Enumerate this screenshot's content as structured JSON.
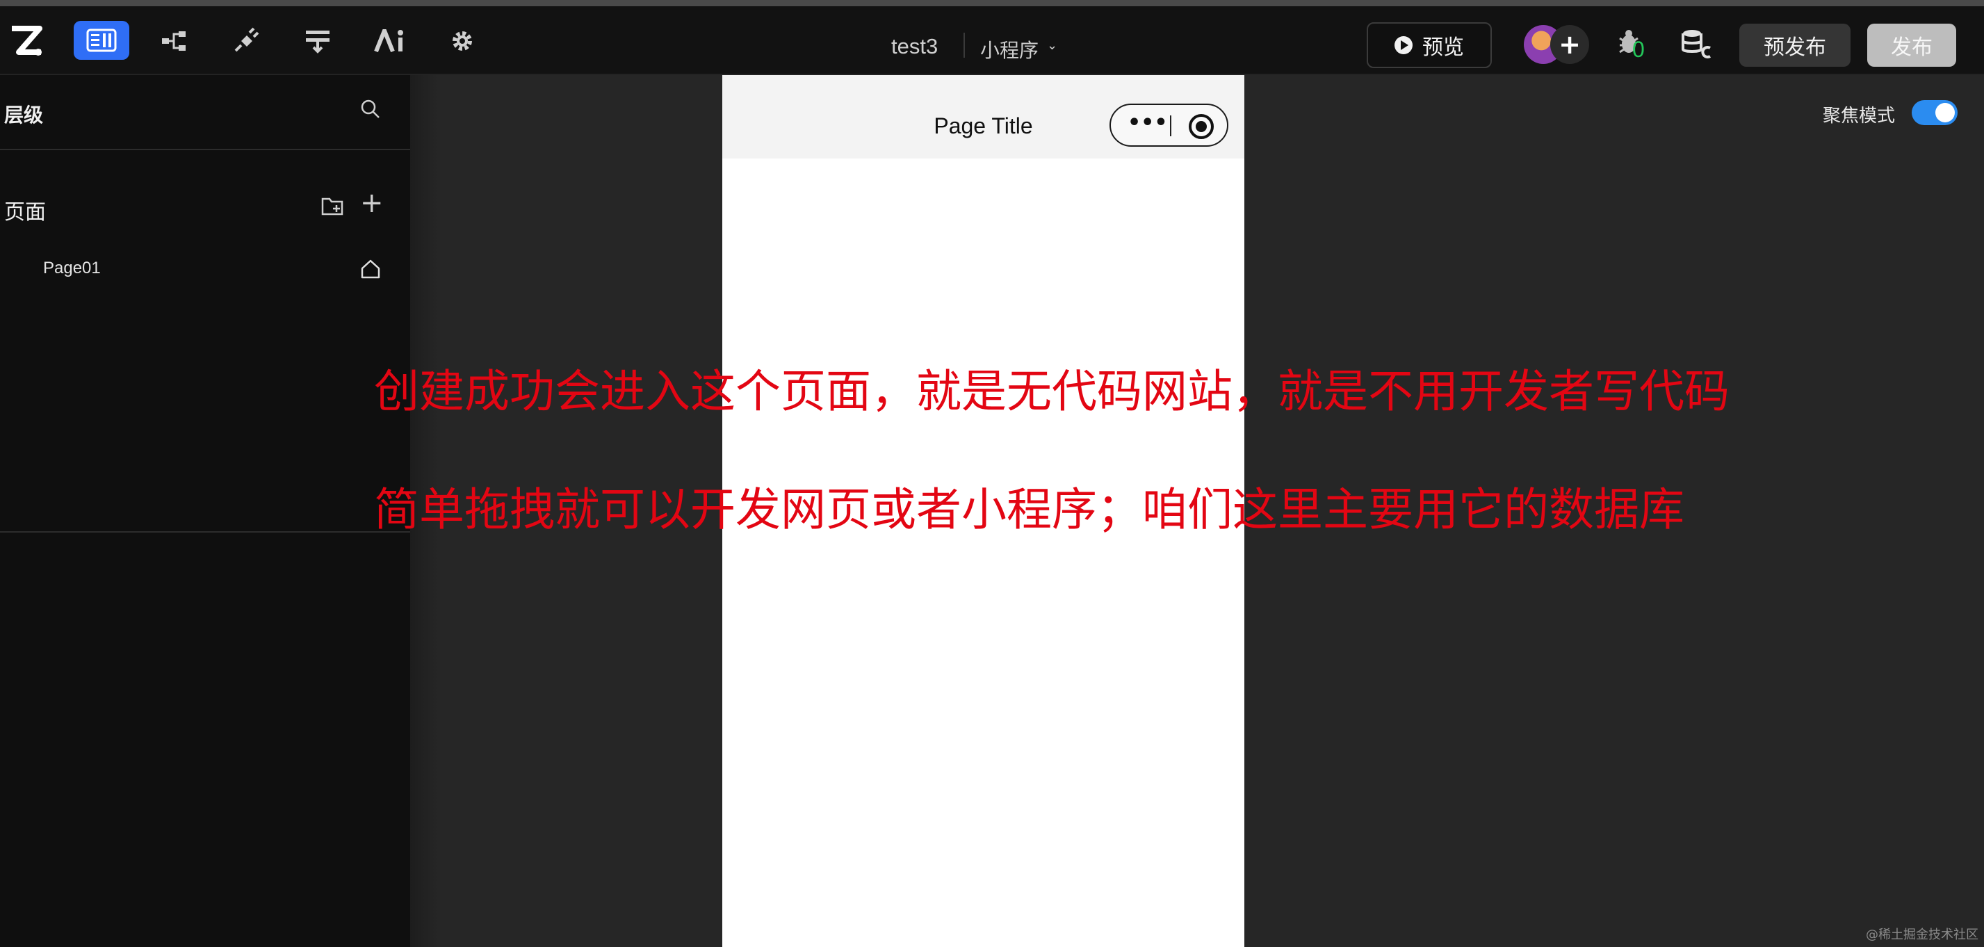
{
  "header": {
    "project_name": "test3",
    "project_type": "小程序",
    "chevron": "⌄",
    "preview_label": "预览",
    "bug_count": "0",
    "prepublish_label": "预发布",
    "publish_label": "发布",
    "add_member": "+",
    "icons": [
      "logo-icon",
      "layout-icon",
      "tree-icon",
      "plugin-icon",
      "filter-icon",
      "ai-icon",
      "gear-icon"
    ]
  },
  "sidebar": {
    "title": "层级",
    "pages_label": "页面",
    "add_symbol": "+",
    "pages": [
      {
        "name": "Page01"
      }
    ]
  },
  "phone": {
    "title": "Page Title",
    "capsule_dots": "•••"
  },
  "canvas": {
    "focus_mode_label": "聚焦模式",
    "focus_mode_on": true
  },
  "annotations": {
    "line1": "创建成功会进入这个页面，就是无代码网站，就是不用开发者写代码",
    "line2": "简单拖拽就可以开发网页或者小程序；咱们这里主要用它的数据库"
  },
  "watermark": "@稀土掘金技术社区",
  "colors": {
    "accent": "#2f6ef6",
    "toggle": "#2b8cf0",
    "annotation": "#e30613",
    "bug_count": "#23c85a"
  }
}
